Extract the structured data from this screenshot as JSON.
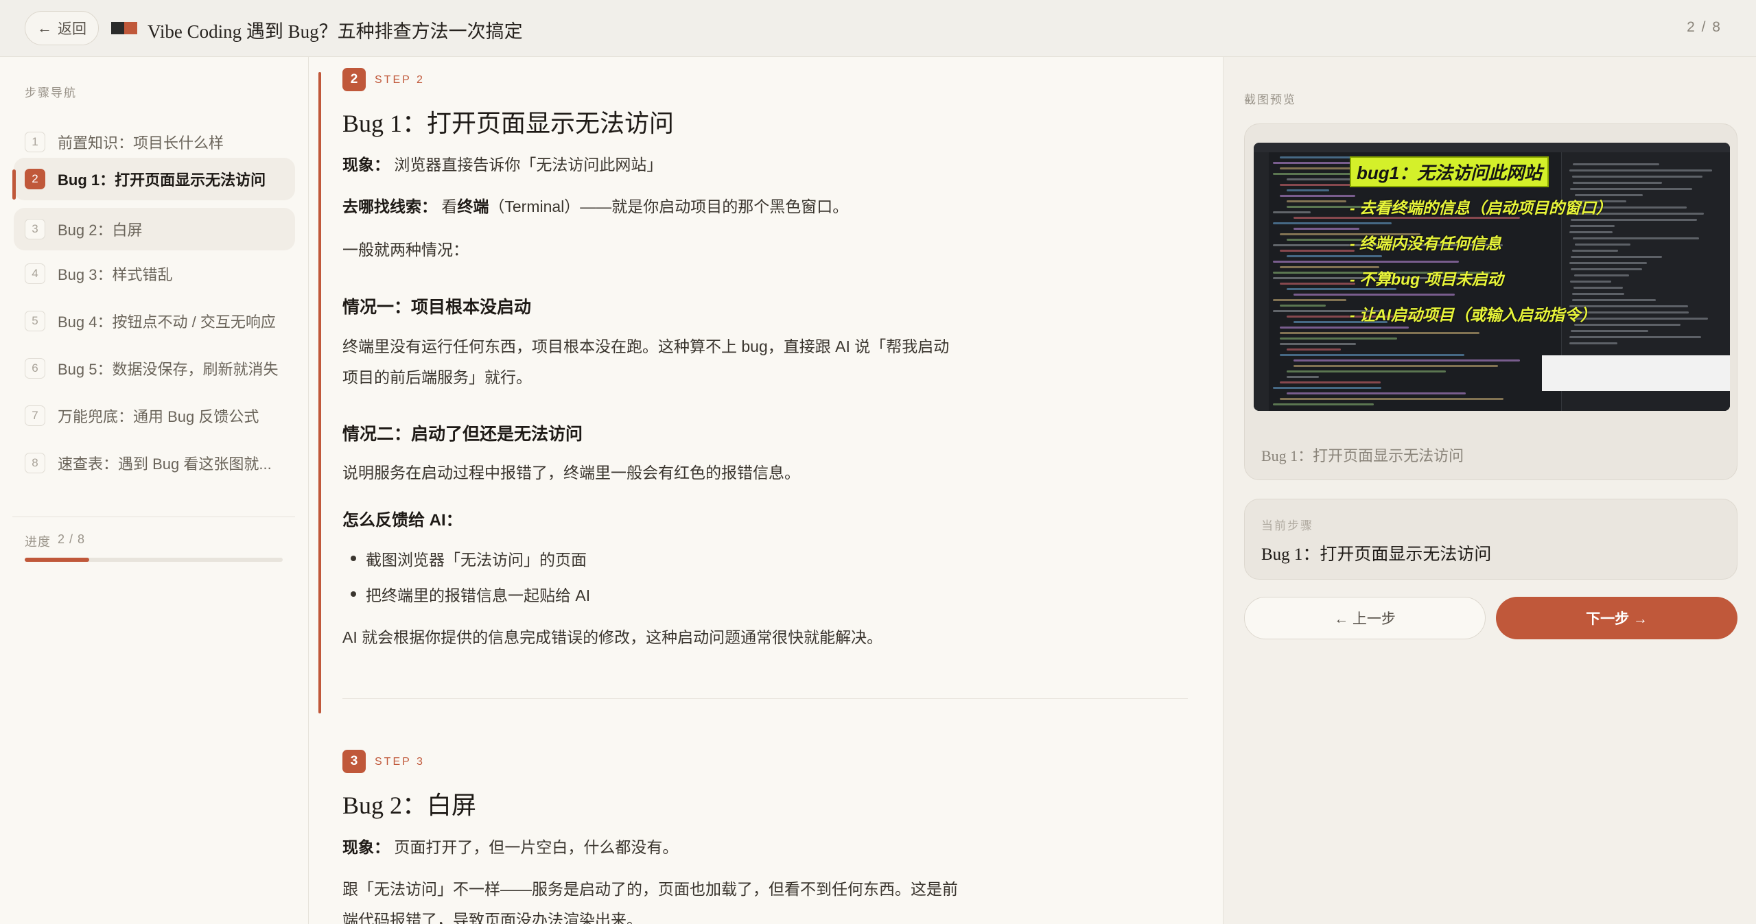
{
  "header": {
    "back_label": "返回",
    "back_icon": "←",
    "title": "Vibe Coding 遇到 Bug？五种排查方法一次搞定",
    "page_indicator": "2 / 8",
    "logo_colors": [
      "#2b2b2b",
      "#c0583a"
    ]
  },
  "sidebar": {
    "title": "步骤导航",
    "items": [
      {
        "num": "1",
        "label": "前置知识：项目长什么样"
      },
      {
        "num": "2",
        "label": "Bug 1：打开页面显示无法访问"
      },
      {
        "num": "3",
        "label": "Bug 2：白屏"
      },
      {
        "num": "4",
        "label": "Bug 3：样式错乱"
      },
      {
        "num": "5",
        "label": "Bug 4：按钮点不动 / 交互无响应"
      },
      {
        "num": "6",
        "label": "Bug 5：数据没保存，刷新就消失"
      },
      {
        "num": "7",
        "label": "万能兜底：通用 Bug 反馈公式"
      },
      {
        "num": "8",
        "label": "速查表：遇到 Bug 看这张图就..."
      }
    ],
    "active_index": 1,
    "progress_label": "进度",
    "progress_text": "2 / 8",
    "progress_fraction": 0.25
  },
  "main": {
    "step2": {
      "badge": "2",
      "tag": "STEP 2",
      "heading": "Bug 1：打开页面显示无法访问",
      "symptom_label": "现象：",
      "symptom_text": "浏览器直接告诉你「无法访问此网站」",
      "clue_label": "去哪找线索：",
      "clue_pre": "看",
      "clue_bold": "终端",
      "clue_post": "（Terminal）——就是你启动项目的那个黑色窗口。",
      "intro": "一般就两种情况：",
      "case1_title": "情况一：项目根本没启动",
      "case1_line1": "终端里没有运行任何东西，项目根本没在跑。这种算不上 bug，直接跟 AI 说「帮我启动",
      "case1_line2": "项目的前后端服务」就行。",
      "case2_title": "情况二：启动了但还是无法访问",
      "case2_text": "说明服务在启动过程中报错了，终端里一般会有红色的报错信息。",
      "feedback_title": "怎么反馈给 AI：",
      "bullets": [
        "截图浏览器「无法访问」的页面",
        "把终端里的报错信息一起贴给 AI"
      ],
      "conclusion": "AI 就会根据你提供的信息完成错误的修改，这种启动问题通常很快就能解决。"
    },
    "step3": {
      "badge": "3",
      "tag": "STEP 3",
      "heading": "Bug 2：白屏",
      "symptom_label": "现象：",
      "symptom_text": "页面打开了，但一片空白，什么都没有。",
      "line1": "跟「无法访问」不一样——服务是启动了的，页面也加载了，但看不到任何东西。这是前",
      "line2": "端代码报错了，导致页面没办法渲染出来。"
    }
  },
  "right_panel": {
    "title": "截图预览",
    "screenshot": {
      "headline": "bug1：无法访问此网站",
      "notes": [
        "- 去看终端的信息（启动项目的窗口）",
        "- 终端内没有任何信息",
        "- 不算bug 项目未启动",
        "- 让AI启动项目（或输入启动指令）"
      ]
    },
    "caption": "Bug 1：打开页面显示无法访问",
    "current_label": "当前步骤",
    "current_value": "Bug 1：打开页面显示无法访问",
    "prev_label": "← 上一步",
    "next_label": "下一步 →",
    "accent_color": "#c0583a"
  }
}
